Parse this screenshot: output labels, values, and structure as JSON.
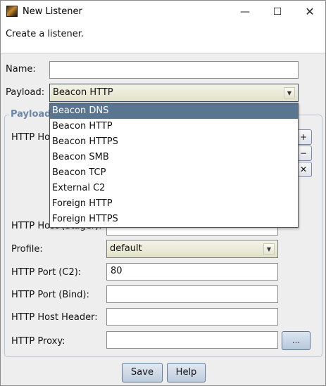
{
  "window": {
    "title": "New Listener",
    "minimize_glyph": "—",
    "maximize_glyph": "☐",
    "close_glyph": "✕"
  },
  "description": "Create a listener.",
  "form": {
    "name_label": "Name:",
    "name_value": "",
    "payload_label": "Payload:",
    "payload_value": "Beacon HTTP"
  },
  "payload_group": {
    "title": "Payload Options",
    "title_visible": "Payload",
    "http_hosts_label": "HTTP Ho",
    "http_host_stager_label": "HTTP Host (Stager):",
    "profile_label": "Profile:",
    "profile_value": "default",
    "port_c2_label": "HTTP Port (C2):",
    "port_c2_value": "80",
    "port_bind_label": "HTTP Port (Bind):",
    "port_bind_value": "",
    "host_header_label": "HTTP Host Header:",
    "host_header_value": "",
    "proxy_label": "HTTP Proxy:",
    "proxy_value": "",
    "proxy_button": "..."
  },
  "payload_options": [
    "Beacon DNS",
    "Beacon HTTP",
    "Beacon HTTPS",
    "Beacon SMB",
    "Beacon TCP",
    "External C2",
    "Foreign HTTP",
    "Foreign HTTPS"
  ],
  "buttons": {
    "save": "Save",
    "help": "Help"
  }
}
